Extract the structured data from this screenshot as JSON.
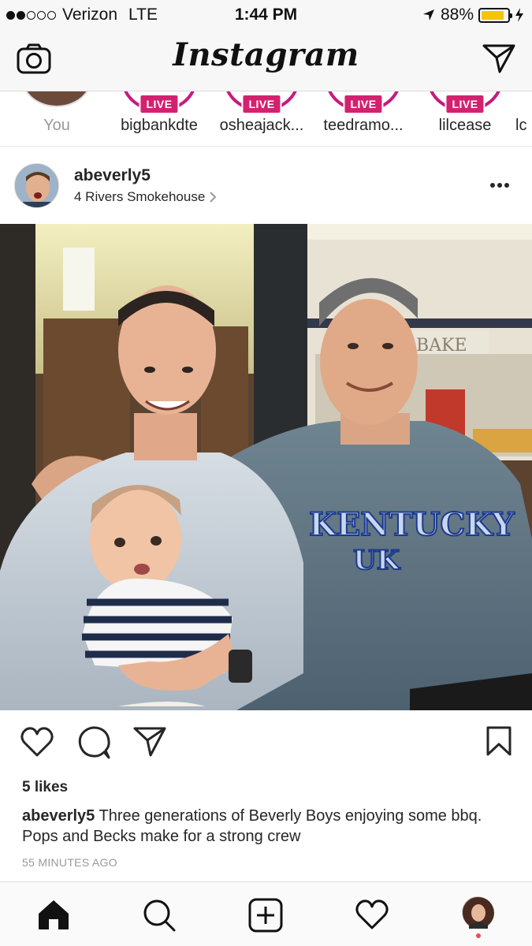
{
  "status_bar": {
    "carrier": "Verizon",
    "network": "LTE",
    "time": "1:44 PM",
    "battery_percent": "88%",
    "battery_level": 0.88,
    "signal_bars_filled": 2,
    "signal_bars_total": 5,
    "icons": [
      "location-arrow-icon",
      "battery-icon",
      "charging-bolt-icon"
    ]
  },
  "top_nav": {
    "app_title": "Instagram",
    "left_icon": "camera-icon",
    "right_icon": "direct-message-icon"
  },
  "stories": [
    {
      "name": "You",
      "live": false
    },
    {
      "name": "bigbankdte",
      "live": true,
      "badge": "LIVE"
    },
    {
      "name": "osheajack...",
      "live": true,
      "badge": "LIVE"
    },
    {
      "name": "teedramo...",
      "live": true,
      "badge": "LIVE"
    },
    {
      "name": "lilcease",
      "live": true,
      "badge": "LIVE"
    },
    {
      "name": "lc",
      "live": false
    }
  ],
  "post": {
    "username": "abeverly5",
    "location": "4 Rivers Smokehouse",
    "more_icon": "more-options-icon",
    "likes": "5 likes",
    "caption_user": "abeverly5",
    "caption_text": "Three generations of Beverly Boys enjoying some bbq. Pops and Becks make for a strong crew",
    "time_ago": "55 MINUTES AGO",
    "photo_signs": [
      "BAKE",
      "KENTUCKY",
      "UK"
    ],
    "actions": [
      "heart-icon",
      "comment-icon",
      "share-icon",
      "bookmark-icon"
    ]
  },
  "tab_bar": {
    "items": [
      "home-icon",
      "search-icon",
      "new-post-icon",
      "activity-heart-icon",
      "profile-avatar"
    ],
    "accent": "#ed4956"
  },
  "colors": {
    "live_badge": "#d2226f",
    "story_ring": "#c8197f",
    "battery_fill": "#f7c500",
    "text": "#262626",
    "muted": "#999999"
  }
}
